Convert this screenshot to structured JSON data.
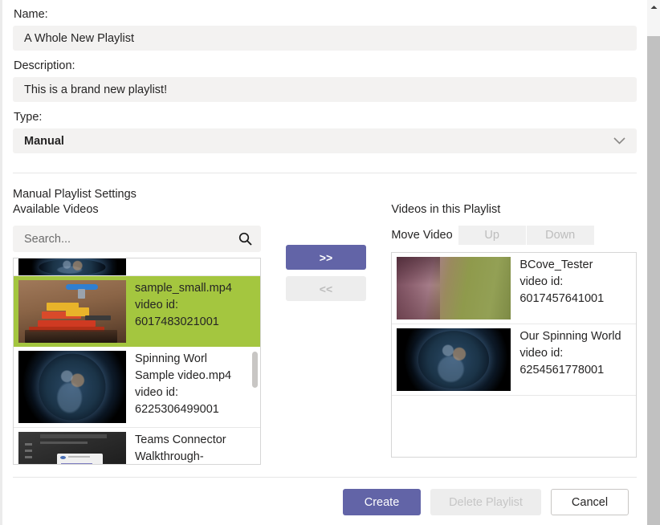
{
  "form": {
    "name_label": "Name:",
    "name_value": "A Whole New Playlist",
    "description_label": "Description:",
    "description_value": "This is a brand new playlist!",
    "type_label": "Type:",
    "type_value": "Manual",
    "type_chevron": "chevron-down-icon"
  },
  "settings": {
    "section_title": "Manual Playlist Settings",
    "available_title": "Available Videos",
    "playlist_title": "Videos in this Playlist",
    "search_placeholder": "Search...",
    "search_value": "",
    "search_icon": "search-icon"
  },
  "transfer": {
    "add_label": ">>",
    "remove_label": "<<"
  },
  "move": {
    "label": "Move Video",
    "up_label": "Up",
    "down_label": "Down"
  },
  "available_videos": [
    {
      "title": "",
      "id_label": "",
      "id_value": "",
      "thumb": "earth-thumbnail",
      "selected": false,
      "partial": true
    },
    {
      "title": "sample_small.mp4",
      "id_label": "video id:",
      "id_value": "6017483021001",
      "thumb": "lego-thumbnail",
      "selected": true,
      "partial": false
    },
    {
      "title": "Spinning Worl Sample video.mp4",
      "id_label": "video id:",
      "id_value": "6225306499001",
      "thumb": "earth-thumbnail",
      "selected": false,
      "partial": false
    },
    {
      "title": "Teams Connector Walkthrough-",
      "id_label": "",
      "id_value": "",
      "thumb": "teams-thumbnail",
      "selected": false,
      "partial": true
    }
  ],
  "playlist_videos": [
    {
      "title": "BCove_Tester",
      "id_label": "video id:",
      "id_value": "6017457641001",
      "thumb": "person-thumbnail"
    },
    {
      "title": "Our Spinning World",
      "id_label": "video id:",
      "id_value": "6254561778001",
      "thumb": "earth-thumbnail"
    }
  ],
  "footer": {
    "create_label": "Create",
    "delete_label": "Delete Playlist",
    "cancel_label": "Cancel"
  },
  "scrollbar": {
    "up_arrow": "scroll-up-arrow-icon"
  },
  "colors": {
    "accent": "#6264a7",
    "selection": "#a4c63f",
    "field_bg": "#f3f2f1",
    "border": "#d6d6d6"
  }
}
